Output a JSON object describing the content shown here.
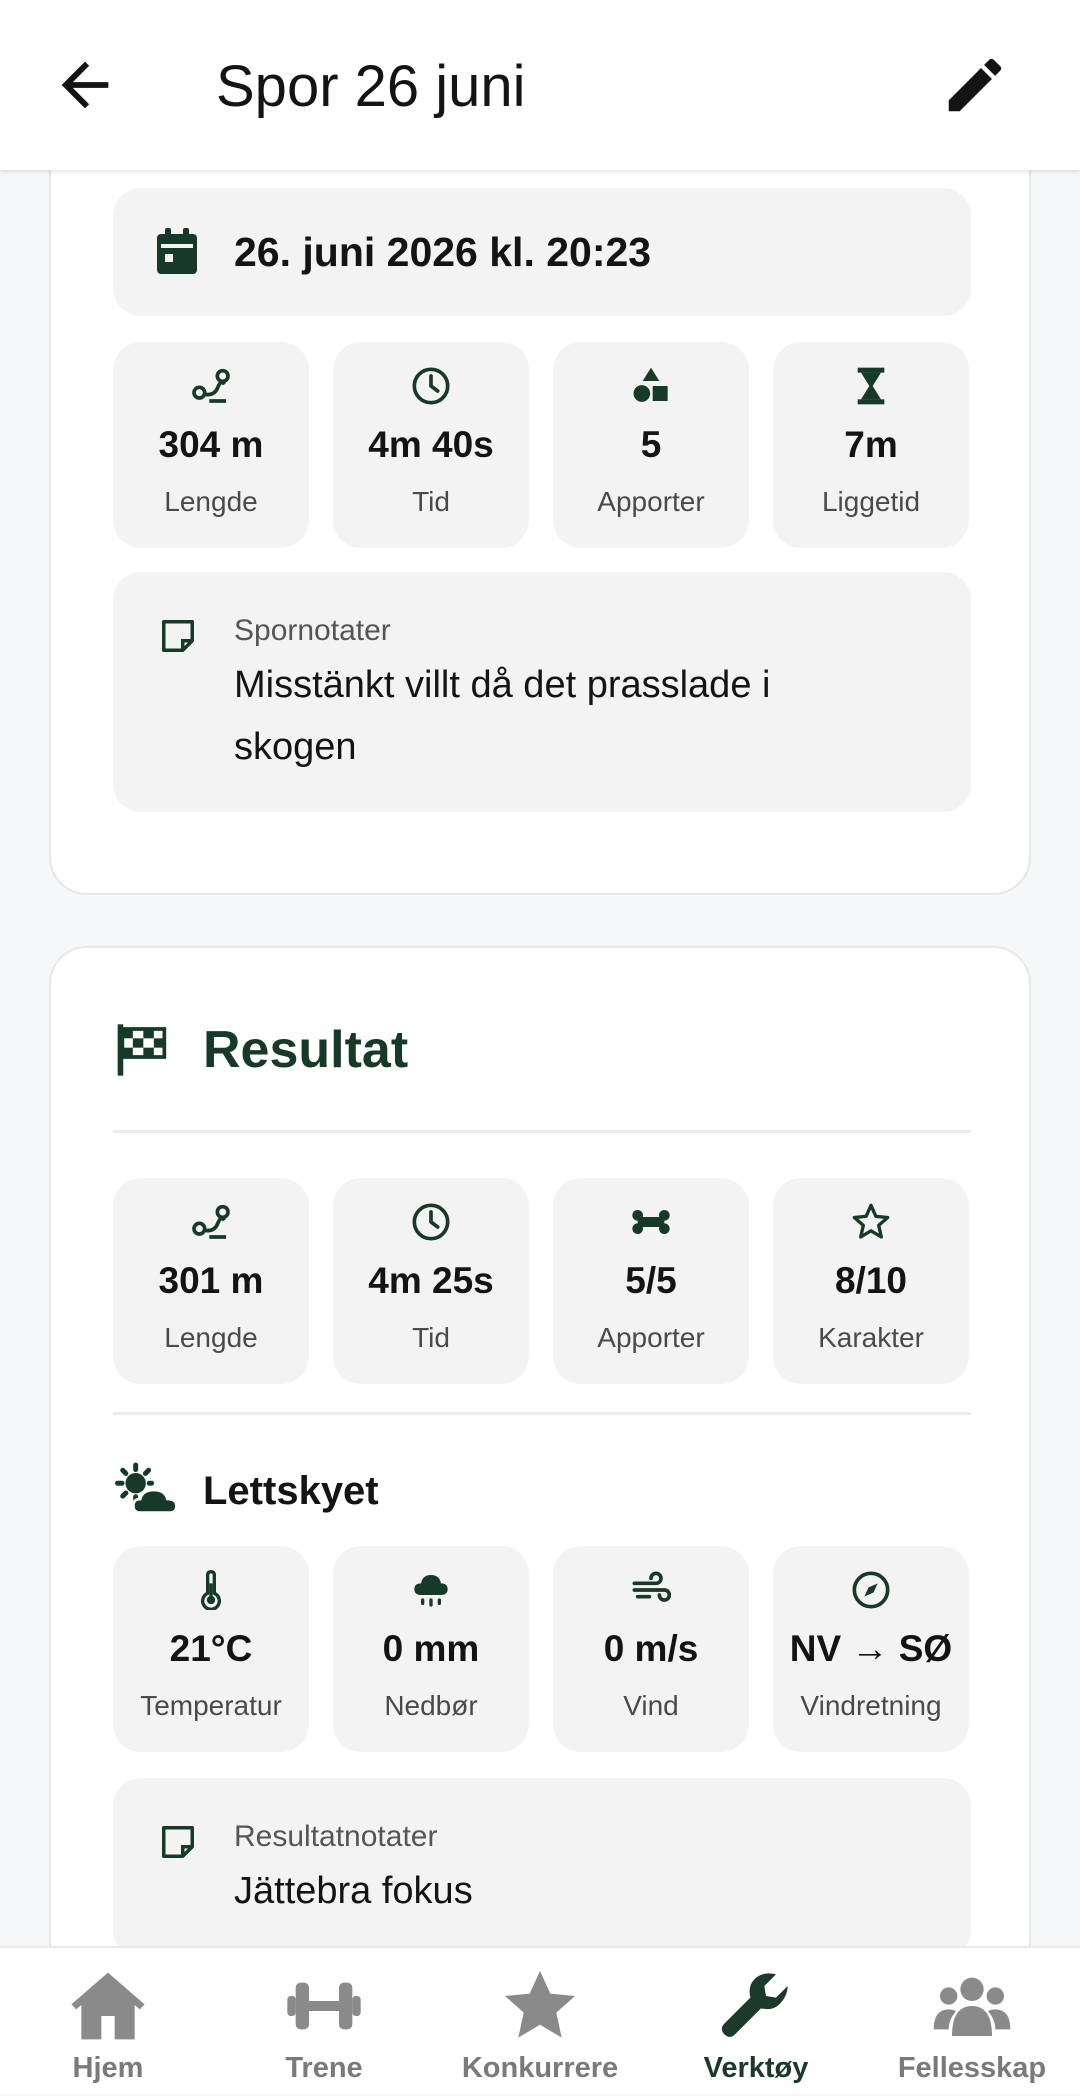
{
  "header": {
    "title": "Spor 26 juni"
  },
  "track": {
    "date": "26. juni 2026 kl. 20:23",
    "stats": [
      {
        "icon": "route-icon",
        "value": "304 m",
        "label": "Lengde"
      },
      {
        "icon": "clock-icon",
        "value": "4m 40s",
        "label": "Tid"
      },
      {
        "icon": "shapes-icon",
        "value": "5",
        "label": "Apporter"
      },
      {
        "icon": "hourglass-icon",
        "value": "7m",
        "label": "Liggetid"
      }
    ],
    "notes": {
      "label": "Spornotater",
      "text": "Misstänkt villt då det prasslade i skogen"
    }
  },
  "result": {
    "title": "Resultat",
    "stats": [
      {
        "icon": "route-icon",
        "value": "301 m",
        "label": "Lengde"
      },
      {
        "icon": "clock-icon",
        "value": "4m 25s",
        "label": "Tid"
      },
      {
        "icon": "bone-icon",
        "value": "5/5",
        "label": "Apporter"
      },
      {
        "icon": "star-icon",
        "value": "8/10",
        "label": "Karakter"
      }
    ],
    "weather": {
      "condition": "Lettskyet",
      "stats": [
        {
          "icon": "thermometer-icon",
          "value": "21°C",
          "label": "Temperatur"
        },
        {
          "icon": "rain-cloud-icon",
          "value": "0 mm",
          "label": "Nedbør"
        },
        {
          "icon": "wind-icon",
          "value": "0 m/s",
          "label": "Vind"
        },
        {
          "icon": "compass-icon",
          "value": "NV → SØ",
          "label": "Vindretning"
        }
      ]
    },
    "notes": {
      "label": "Resultatnotater",
      "text": "Jättebra fokus"
    }
  },
  "nav": {
    "items": [
      {
        "label": "Hjem",
        "icon": "home-icon",
        "active": false
      },
      {
        "label": "Trene",
        "icon": "dumbbell-icon",
        "active": false
      },
      {
        "label": "Konkurrere",
        "icon": "star-icon",
        "active": false
      },
      {
        "label": "Verktøy",
        "icon": "wrench-icon",
        "active": true
      },
      {
        "label": "Fellesskap",
        "icon": "users-icon",
        "active": false
      }
    ]
  },
  "colors": {
    "accent": "#173a28",
    "tile": "#f3f3f3",
    "inactive": "#7a7a7a"
  }
}
